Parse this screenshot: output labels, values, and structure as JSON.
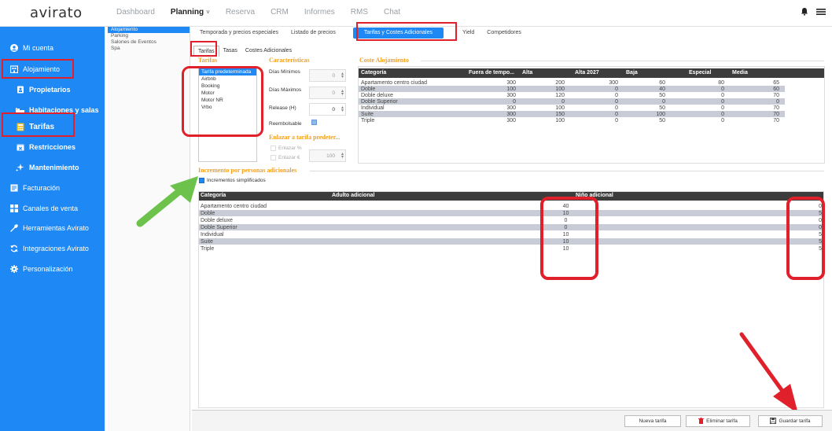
{
  "app": {
    "logo": "avirato"
  },
  "topnav": {
    "items": [
      "Dashboard",
      "Planning",
      "Reserva",
      "CRM",
      "Informes",
      "RMS",
      "Chat"
    ],
    "active": "Planning",
    "caret": "˅"
  },
  "top_icons": {
    "bell": "bell-icon",
    "menu": "hamburger-icon"
  },
  "sidebar": {
    "items": [
      {
        "label": "Mi cuenta",
        "icon": "user-icon"
      },
      {
        "label": "Alojamiento",
        "icon": "building-icon"
      },
      {
        "label": "Propietarios",
        "icon": "person-icon"
      },
      {
        "label": "Habitaciones y salas",
        "icon": "bed-icon"
      },
      {
        "label": "Tarifas",
        "icon": "calculator-icon"
      },
      {
        "label": "Restricciones",
        "icon": "calendar-x-icon"
      },
      {
        "label": "Mantenimiento",
        "icon": "sparkle-icon"
      },
      {
        "label": "Facturación",
        "icon": "invoice-icon"
      },
      {
        "label": "Canales de venta",
        "icon": "grid-icon"
      },
      {
        "label": "Herramientas Avirato",
        "icon": "wrench-icon"
      },
      {
        "label": "Integraciones Avirato",
        "icon": "sync-icon"
      },
      {
        "label": "Personalización",
        "icon": "gear-icon"
      }
    ]
  },
  "subpanel": {
    "items": [
      "Alojamiento",
      "Parking",
      "Salones de Eventos",
      "Spa"
    ],
    "selected": "Alojamiento"
  },
  "tabs": [
    "Temporada y precios especiales",
    "Listado de precios",
    "Tarifas y Costes Adicionales",
    "Yield",
    "Competidores"
  ],
  "active_tab": "Tarifas y Costes Adicionales",
  "subtabs": [
    "Tarifas",
    "Tasas",
    "Costes Adicionales"
  ],
  "active_subtab": "Tarifas",
  "tarifas": {
    "title": "Tarifas",
    "list": [
      "Tarifa predeterminada",
      "Airbnb",
      "Booking",
      "Motor",
      "Motor NR",
      "Vrbo"
    ],
    "selected": "Tarifa predeterminada"
  },
  "caracteristicas": {
    "title": "Características",
    "dias_minimos": {
      "label": "Días Mínimos",
      "value": "0"
    },
    "dias_maximos": {
      "label": "Días Máximos",
      "value": "0"
    },
    "release": {
      "label": "Release (H)",
      "value": "0"
    },
    "reembolsable": {
      "label": "Reembolsable",
      "checked": true
    }
  },
  "enlazar": {
    "title": "Enlazar a tarifa predeter...",
    "pct_label": "Enlazar %",
    "eur_label": "Enlazar €",
    "value": "100"
  },
  "coste": {
    "title": "Coste Alojamiento",
    "headers": [
      "Categoría",
      "Fuera de tempo...",
      "Alta",
      "Alta 2027",
      "Baja",
      "Especial",
      "Media"
    ],
    "rows": [
      [
        "Apartamento centro ciudad",
        "300",
        "200",
        "300",
        "60",
        "80",
        "65"
      ],
      [
        "Doble",
        "100",
        "100",
        "0",
        "40",
        "0",
        "60"
      ],
      [
        "Doble deluxe",
        "300",
        "120",
        "0",
        "50",
        "0",
        "70"
      ],
      [
        "Doble Superior",
        "0",
        "0",
        "0",
        "0",
        "0",
        "0"
      ],
      [
        "Individual",
        "300",
        "100",
        "0",
        "50",
        "0",
        "70"
      ],
      [
        "Suite",
        "300",
        "150",
        "0",
        "100",
        "0",
        "70"
      ],
      [
        "Triple",
        "300",
        "100",
        "0",
        "50",
        "0",
        "70"
      ]
    ]
  },
  "incremento": {
    "title": "Incremento por personas adicionales",
    "checkbox_label": "Incrementos simplificados",
    "headers": [
      "Categoría",
      "Adulto adicional",
      "Niño adicional"
    ],
    "rows": [
      [
        "Apartamento centro ciudad",
        "40",
        "0"
      ],
      [
        "Doble",
        "10",
        "5"
      ],
      [
        "Doble deluxe",
        "0",
        "0"
      ],
      [
        "Doble Superior",
        "0",
        "0"
      ],
      [
        "Individual",
        "10",
        "5"
      ],
      [
        "Suite",
        "10",
        "5"
      ],
      [
        "Triple",
        "10",
        "5"
      ]
    ]
  },
  "bottom": {
    "nueva": "Nueva tarifa",
    "eliminar": "Eliminar tarifa",
    "guardar": "Guardar tarifa"
  },
  "colors": {
    "accent": "#1e88f5",
    "orange": "#f0a020",
    "highlight": "#e0202a",
    "arrow_green": "#6cc24a"
  }
}
